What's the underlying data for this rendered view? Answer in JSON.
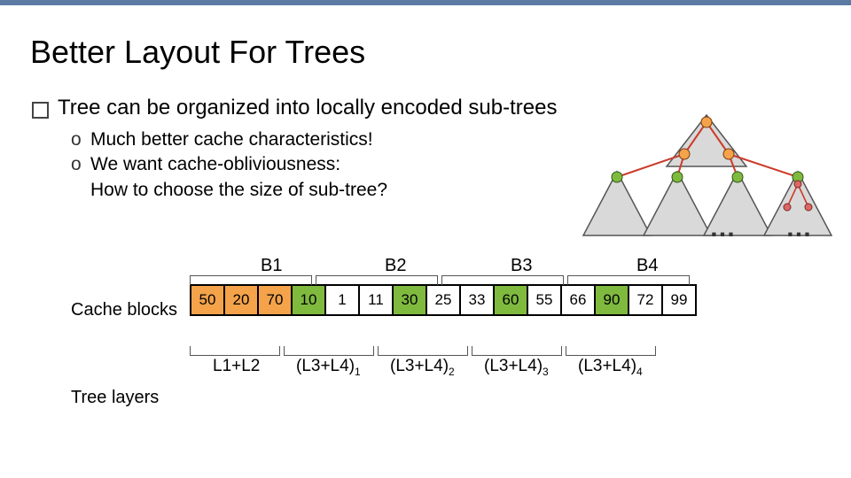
{
  "title": "Better Layout For Trees",
  "main_bullet": "Tree can be organized into locally encoded sub-trees",
  "subs": {
    "a": "Much better cache characteristics!",
    "b1": "We want cache-obliviousness:",
    "b2": "How to choose the size of sub-tree?"
  },
  "labels": {
    "cache_blocks": "Cache blocks",
    "tree_layers": "Tree layers",
    "B1": "B1",
    "B2": "B2",
    "B3": "B3",
    "B4": "B4",
    "L12": "L1+L2",
    "L34": "(L3+L4)"
  },
  "cells": [
    "50",
    "20",
    "70",
    "10",
    "1",
    "11",
    "30",
    "25",
    "33",
    "60",
    "55",
    "66",
    "90",
    "72",
    "99"
  ],
  "ellipsis": "…"
}
